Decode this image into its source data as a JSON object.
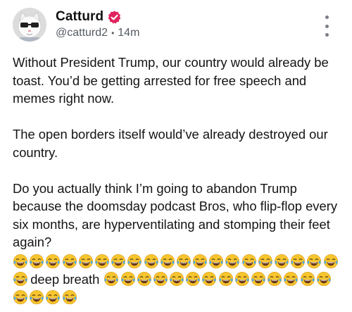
{
  "author": {
    "display_name": "Catturd",
    "handle": "@catturd2",
    "separator": "•",
    "timestamp": "14m",
    "verified_color": "#e0245e"
  },
  "more_menu": {
    "icon": "more-vertical-icon"
  },
  "post": {
    "paragraphs": [
      "Without President Trump, our country would already be toast. You’d be getting arrested for free speech and memes right now.",
      "The open borders itself would’ve already destroyed our country.",
      "Do you actually think I’m going to abandon Trump because the doomsday podcast Bros, who flip-flop every six months, are hyperventilating and stomping their feet again?"
    ],
    "emoji_lines": [
      {
        "before": 20,
        "text": "",
        "after": 0
      },
      {
        "before": 1,
        "text": "deep breath ",
        "after": 14
      },
      {
        "before": 4,
        "text": "",
        "after": 0
      }
    ],
    "emoji_name": "face-with-tears-of-joy-icon"
  }
}
